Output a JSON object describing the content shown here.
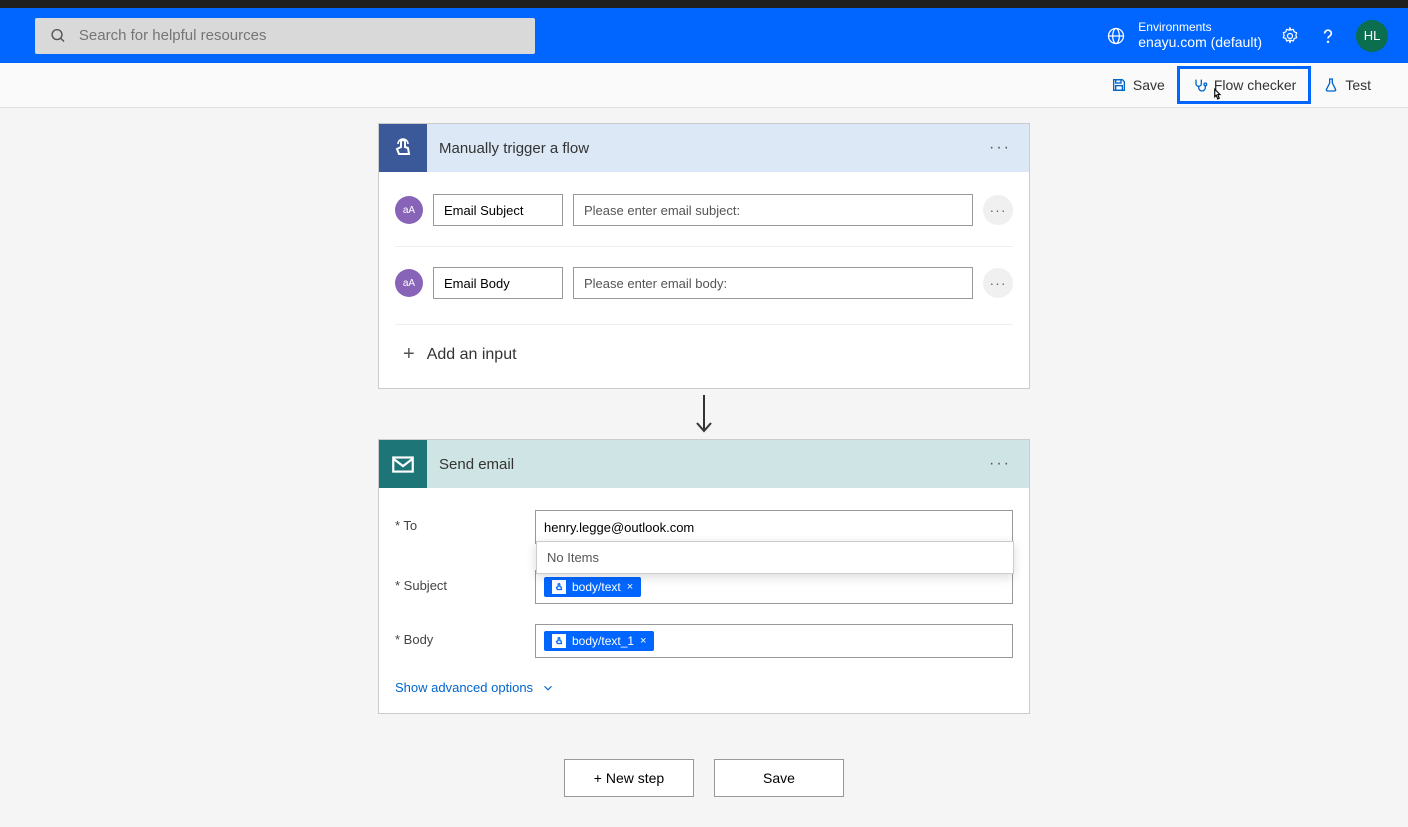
{
  "header": {
    "search_placeholder": "Search for helpful resources",
    "env_label": "Environments",
    "env_name": "enayu.com (default)",
    "avatar_initials": "HL"
  },
  "toolbar": {
    "save": "Save",
    "flow_checker": "Flow checker",
    "test": "Test"
  },
  "trigger": {
    "title": "Manually trigger a flow",
    "inputs": [
      {
        "name": "Email Subject",
        "placeholder": "Please enter email subject:",
        "badge": "aA"
      },
      {
        "name": "Email Body",
        "placeholder": "Please enter email body:",
        "badge": "aA"
      }
    ],
    "add_input": "Add an input"
  },
  "action": {
    "title": "Send email",
    "fields": {
      "to_label": "* To",
      "to_value": "henry.legge@outlook.com",
      "subject_label": "* Subject",
      "subject_token": "body/text",
      "body_label": "* Body",
      "body_token": "body/text_1"
    },
    "dropdown_text": "No Items",
    "show_advanced": "Show advanced options"
  },
  "bottom": {
    "new_step": "+ New step",
    "save": "Save"
  }
}
